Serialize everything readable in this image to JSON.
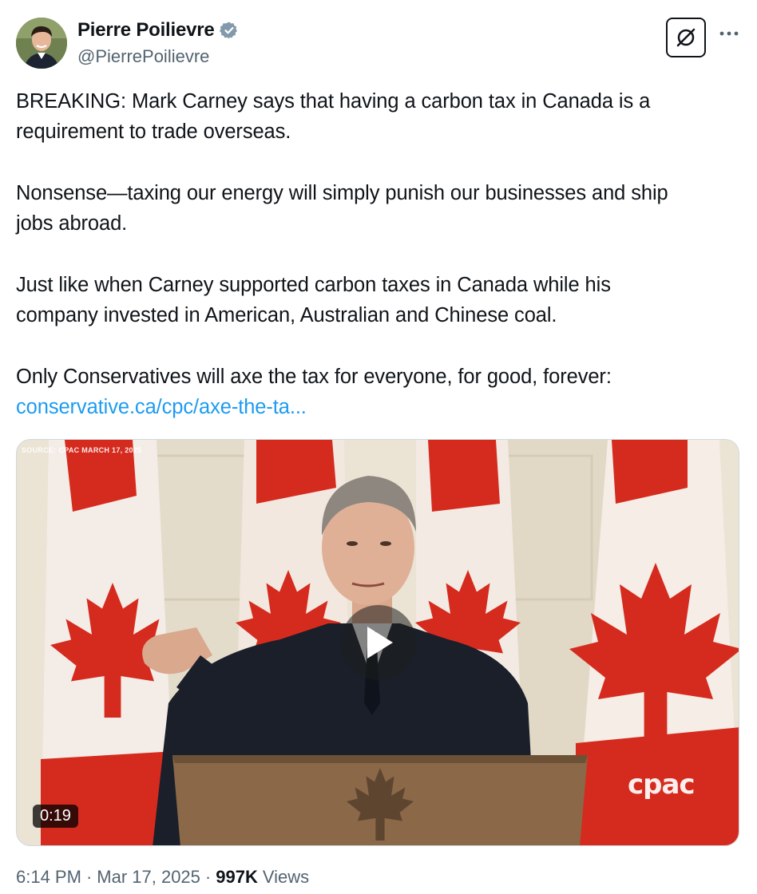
{
  "author": {
    "display_name": "Pierre Poilievre",
    "handle": "@PierrePoilievre",
    "verified": true,
    "avatar_icon": "profile-photo"
  },
  "actions": {
    "grok_icon": "grok-slash-icon",
    "more_icon": "ellipsis-icon"
  },
  "tweet": {
    "paragraphs": [
      "BREAKING: Mark Carney says that having a carbon tax in Canada is a\nrequirement to trade overseas.",
      "Nonsense—taxing our energy will simply punish our businesses and ship\njobs abroad.",
      "Just like when Carney supported carbon taxes in Canada while his\ncompany invested in American, Australian and Chinese coal.",
      "Only Conservatives will axe the tax for everyone, for good, forever:"
    ],
    "link_text": "conservative.ca/cpc/axe-the-ta..."
  },
  "video": {
    "source_label": "SOURCE: CPAC  MARCH 17, 2025",
    "watermark": "cpac",
    "duration": "0:19",
    "play_icon": "play-icon"
  },
  "footer": {
    "time": "6:14 PM",
    "separator": "·",
    "date": "Mar 17, 2025",
    "views_count": "997K",
    "views_label": "Views"
  },
  "colors": {
    "link": "#1d9bf0",
    "verified": "#829aab",
    "secondary_text": "#536471",
    "flag_red": "#d52b1e"
  }
}
